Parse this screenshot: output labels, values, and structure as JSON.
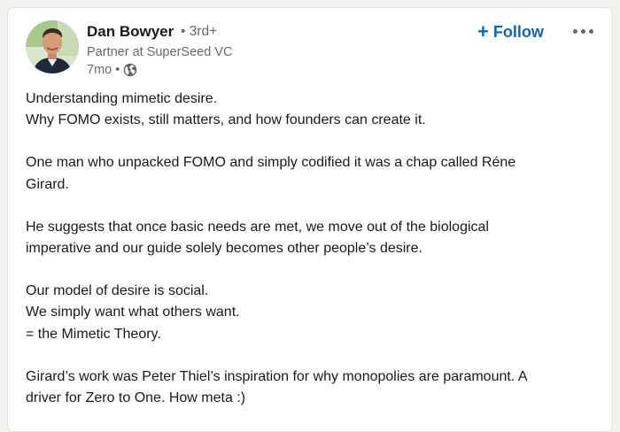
{
  "post": {
    "author": {
      "name": "Dan Bowyer",
      "degree": "• 3rd+",
      "headline": "Partner at SuperSeed VC",
      "time": "7mo •",
      "visibility_icon": "globe-icon"
    },
    "follow_label": "Follow",
    "more_icon": "more-options-icon",
    "paragraphs": [
      [
        "Understanding mimetic desire.",
        "Why FOMO exists, still matters, and how founders can create it."
      ],
      [
        "One man who unpacked FOMO and simply codified it was a chap called Réne",
        "Girard."
      ],
      [
        "He suggests that once basic needs are met, we move out of the biological",
        "imperative and our guide solely becomes other people’s desire."
      ],
      [
        "Our model of desire is social.",
        "We simply want what others want.",
        "= the Mimetic Theory."
      ],
      [
        "Girard’s work was Peter Thiel’s inspiration for why monopolies are paramount. A",
        "driver for Zero to One. How meta :)"
      ]
    ]
  },
  "colors": {
    "accent": "#0a66c2",
    "text_primary": "#1a1a1a",
    "text_secondary": "#666666",
    "card_bg": "#ffffff",
    "page_bg": "#f4f2ee"
  }
}
